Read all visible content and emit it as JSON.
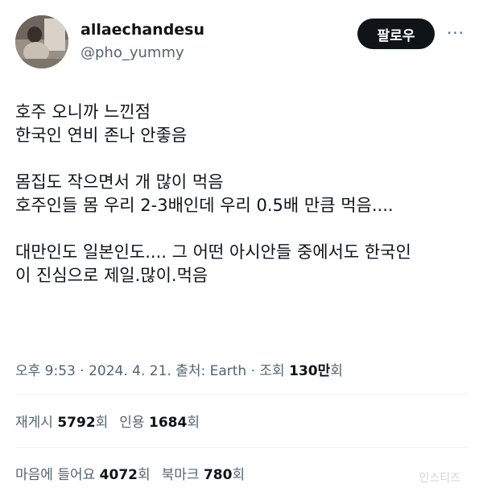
{
  "author": {
    "display_name": "allaechandesu",
    "handle": "@pho_yummy",
    "avatar": "profile-photo"
  },
  "actions": {
    "follow_label": "팔로우",
    "more_icon": "more-horizontal-icon",
    "more_glyph": "···"
  },
  "tweet": {
    "lines": [
      "호주 오니까 느낀점",
      "한국인 연비 존나 안좋음",
      "",
      "몸집도 작으면서 개 많이 먹음",
      "호주인들 몸 우리 2-3배인데 우리 0.5배 만큼 먹음....",
      "",
      "대만인도 일본인도.... 그 어떤 아시안들 중에서도 한국인",
      "이 진심으로 제일.많이.먹음"
    ]
  },
  "meta": {
    "time_date_source": "오후 9:53 · 2024. 4. 21. 출처: Earth · 조회 ",
    "views": "130만",
    "views_unit": "회"
  },
  "stats": {
    "reposts_label": "재게시",
    "reposts_value": "5792",
    "reposts_unit": "회",
    "quotes_label": "인용",
    "quotes_value": "1684",
    "quotes_unit": "회",
    "likes_label": "마음에 들어요",
    "likes_value": "4072",
    "likes_unit": "회",
    "bookmarks_label": "북마크",
    "bookmarks_value": "780",
    "bookmarks_unit": "회"
  },
  "watermark": "인스티즈"
}
